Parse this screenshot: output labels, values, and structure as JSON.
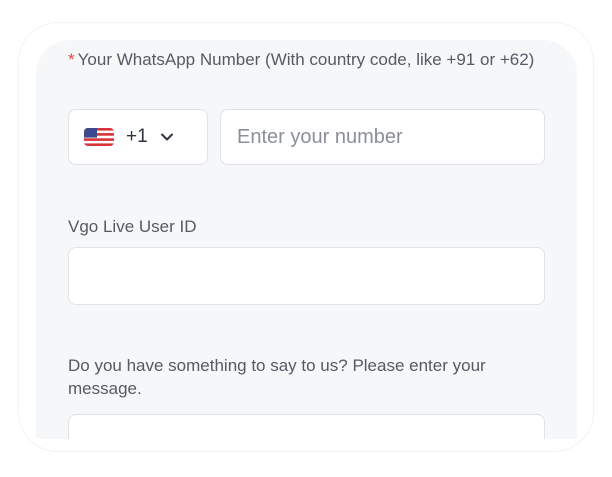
{
  "form": {
    "whatsapp": {
      "required_mark": "*",
      "label": "Your WhatsApp Number (With country code, like +91 or +62)",
      "country": {
        "flag_icon": "us-flag-icon",
        "code": "+1",
        "dropdown_icon": "chevron-down-icon"
      },
      "value": "",
      "placeholder": "Enter your number"
    },
    "user_id": {
      "label": "Vgo Live User ID",
      "value": ""
    },
    "message": {
      "label": "Do you have something to say to us? Please enter your message.",
      "value": ""
    }
  },
  "colors": {
    "card_background": "#f6f7f9",
    "required_mark": "#e8403f",
    "label_text": "#555a63",
    "input_border": "#dfe2e7"
  }
}
